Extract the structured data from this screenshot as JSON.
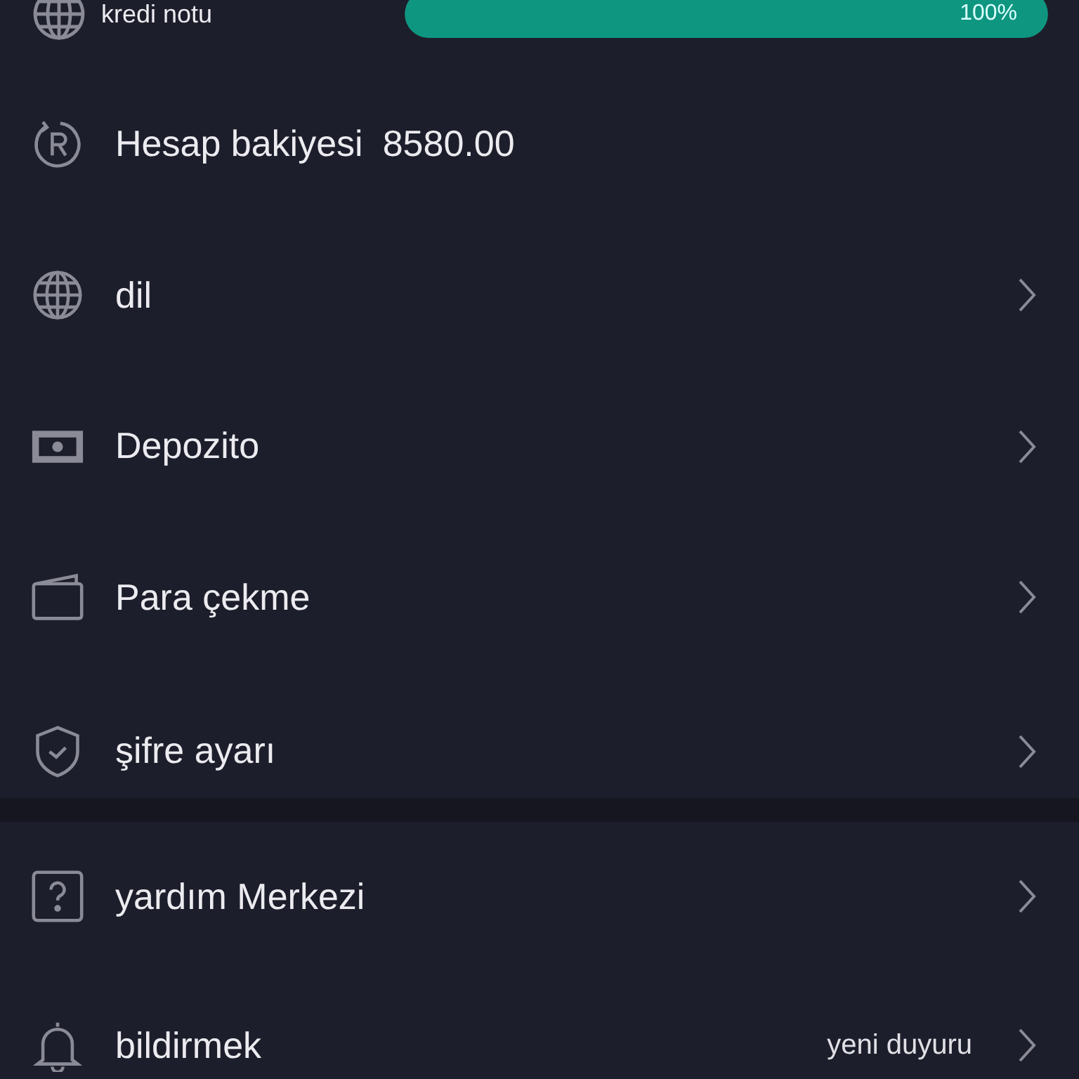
{
  "credit": {
    "label": "kredi notu",
    "level": 1,
    "reading": "100%"
  },
  "sections": [
    [
      {
        "kind": "value",
        "label": "Hesap bakiyesi",
        "value": "8580.00"
      },
      {
        "kind": "link",
        "label": "dil"
      },
      {
        "kind": "link",
        "label": "Depozito"
      },
      {
        "kind": "link",
        "label": "Para çekme"
      },
      {
        "kind": "link",
        "label": "şifre ayarı"
      }
    ],
    [
      {
        "kind": "link",
        "label": "yardım Merkezi"
      },
      {
        "kind": "link",
        "label": "bildirmek",
        "note": "yeni duyuru"
      }
    ]
  ]
}
